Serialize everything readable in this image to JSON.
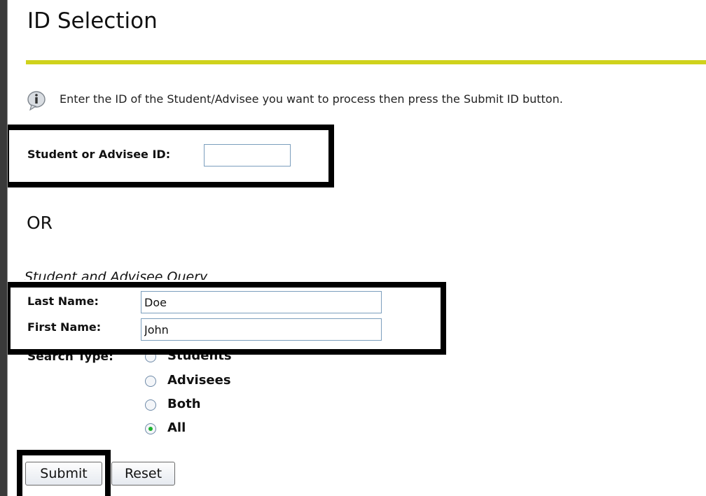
{
  "page": {
    "title": "ID Selection",
    "info_message": "Enter the ID of the Student/Advisee you want to process then press the Submit ID button."
  },
  "id_lookup": {
    "label": "Student or Advisee ID:",
    "value": ""
  },
  "or_label": "OR",
  "query": {
    "heading": "Student and Advisee Query",
    "last_name_label": "Last Name:",
    "last_name_value": "Doe",
    "first_name_label": "First Name:",
    "first_name_value": "John",
    "search_type_label": "Search Type:",
    "search_type_options": [
      "Students",
      "Advisees",
      "Both",
      "All"
    ],
    "search_type_selected": "All"
  },
  "buttons": {
    "submit": "Submit",
    "reset": "Reset"
  },
  "colors": {
    "title_rule": "#cfd21c",
    "highlight_border": "#000000",
    "radio_selected": "#1db22e"
  },
  "icons": {
    "info": "info-icon"
  }
}
